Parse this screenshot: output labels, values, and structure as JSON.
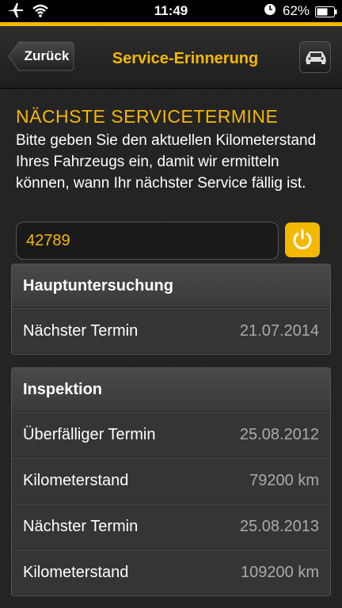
{
  "status_bar": {
    "time": "11:49",
    "battery": "62%"
  },
  "nav": {
    "back_label": "Zurück",
    "title": "Service-Erinnerung"
  },
  "section": {
    "heading": "NÄCHSTE SERVICETERMINE",
    "description": "Bitte geben Sie den aktuellen Kilometerstand Ihres Fahrzeugs ein, damit wir ermitteln können, wann Ihr nächster Service fällig ist."
  },
  "mileage_input": {
    "value": "42789"
  },
  "hauptuntersuchung": {
    "title": "Hauptuntersuchung",
    "rows": [
      {
        "label": "Nächster Termin",
        "value": "21.07.2014"
      }
    ]
  },
  "inspektion": {
    "title": "Inspektion",
    "rows": [
      {
        "label": "Überfälliger Termin",
        "value": "25.08.2012"
      },
      {
        "label": "Kilometerstand",
        "value": "79200 km"
      },
      {
        "label": "Nächster Termin",
        "value": "25.08.2013"
      },
      {
        "label": "Kilometerstand",
        "value": "109200 km"
      }
    ]
  },
  "colors": {
    "accent": "#f5b800",
    "background": "#1c1c1c"
  },
  "icons": [
    "airplane-icon",
    "wifi-icon",
    "clock-icon",
    "battery-icon",
    "car-icon",
    "refresh-icon"
  ]
}
